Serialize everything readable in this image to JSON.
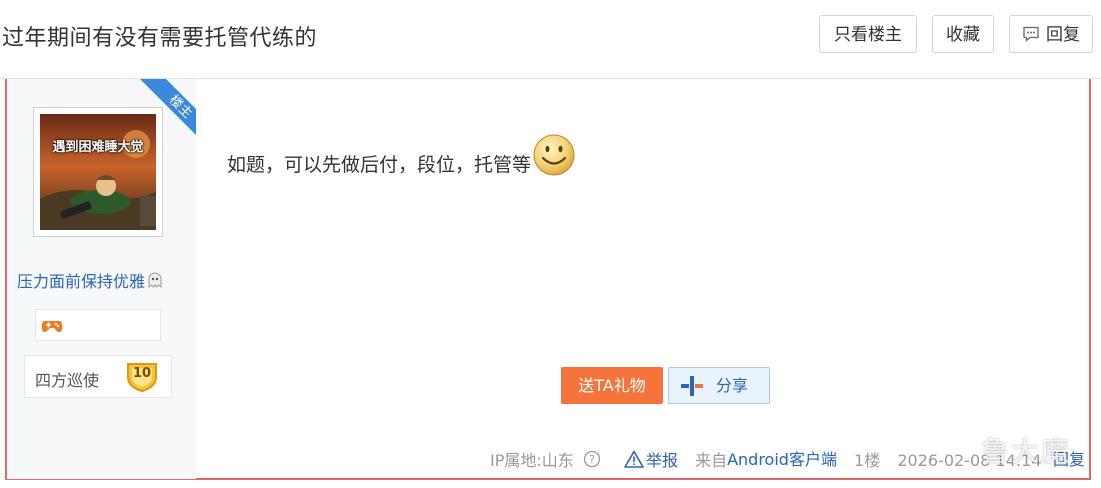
{
  "header": {
    "title": "过年期间有没有需要托管代练的",
    "only_lz_label": "只看楼主",
    "favorite_label": "收藏",
    "reply_label": "回复"
  },
  "author": {
    "badge_label": "楼主",
    "avatar_caption": "遇到困难睡大觉",
    "username": "压力面前保持优雅",
    "level_title": "四方巡使",
    "level_number": "10"
  },
  "post": {
    "content": "如题，可以先做后付，段位，托管等",
    "emoji": "smiley-icon"
  },
  "actions": {
    "gift_label": "送TA礼物",
    "share_label": "分享"
  },
  "footer": {
    "ip_location": "IP属地:山东",
    "report_label": "举报",
    "source_prefix": "来自",
    "source_client": "Android客户端",
    "floor": "1楼",
    "timestamp": "2026-02-08 14:14",
    "reply_label": "回复"
  },
  "watermark": "鲁大魔",
  "colors": {
    "frame": "#e06868",
    "link": "#2d64b3",
    "gift": "#f5743b",
    "badge": "#3b88d8"
  }
}
